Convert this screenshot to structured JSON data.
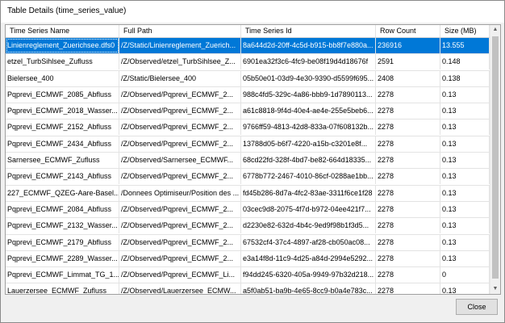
{
  "window": {
    "title": "Table Details (time_series_value)"
  },
  "table": {
    "columns": [
      "Time Series Name",
      "Full Path",
      "Time Series Id",
      "Row Count",
      "Size (MB)"
    ],
    "rows": [
      [
        "Linienreglement_Zuerichsee.dfs0",
        "/Z/Static/Linienreglement_Zuerich...",
        "8a644d2d-20ff-4c5d-b915-bb8f7e880a...",
        "236916",
        "13.555"
      ],
      [
        "etzel_TurbSihlsee_Zufluss",
        "/Z/Observed/etzel_TurbSihlsee_Z...",
        "6901ea32f3c6-4fc9-be08f19d4d18676f",
        "2591",
        "0.148"
      ],
      [
        "Bielersee_400",
        "/Z/Static/Bielersee_400",
        "05b50e01-03d9-4e30-9390-d5599f695...",
        "2408",
        "0.138"
      ],
      [
        "Pqprevi_ECMWF_2085_Abfluss",
        "/Z/Observed/Pqprevi_ECMWF_2...",
        "988c4fd5-329c-4a86-bbb9-1d7890113...",
        "2278",
        "0.13"
      ],
      [
        "Pqprevi_ECMWF_2018_Wasser...",
        "/Z/Observed/Pqprevi_ECMWF_2...",
        "a61c8818-9f4d-40e4-ae4e-255e5beb6...",
        "2278",
        "0.13"
      ],
      [
        "Pqprevi_ECMWF_2152_Abfluss",
        "/Z/Observed/Pqprevi_ECMWF_2...",
        "9766ff59-4813-42d8-833a-07f608132b...",
        "2278",
        "0.13"
      ],
      [
        "Pqprevi_ECMWF_2434_Abfluss",
        "/Z/Observed/Pqprevi_ECMWF_2...",
        "13788d05-b6f7-4220-a15b-c3201e8f...",
        "2278",
        "0.13"
      ],
      [
        "Sarnersee_ECMWF_Zufluss",
        "/Z/Observed/Sarnersee_ECMWF...",
        "68cd22fd-328f-4bd7-be82-664d18335...",
        "2278",
        "0.13"
      ],
      [
        "Pqprevi_ECMWF_2143_Abfluss",
        "/Z/Observed/Pqprevi_ECMWF_2...",
        "6778b772-2467-4010-86cf-0288ae1bb...",
        "2278",
        "0.13"
      ],
      [
        "227_ECMWF_QZEG-Aare-Basel...",
        "/Donnees Optimiseur/Position des ...",
        "fd45b286-8d7a-4fc2-83ae-3311f6ce1f28",
        "2278",
        "0.13"
      ],
      [
        "Pqprevi_ECMWF_2084_Abfluss",
        "/Z/Observed/Pqprevi_ECMWF_2...",
        "03cec9d8-2075-4f7d-b972-04ee421f7...",
        "2278",
        "0.13"
      ],
      [
        "Pqprevi_ECMWF_2132_Wasser...",
        "/Z/Observed/Pqprevi_ECMWF_2...",
        "d2230e82-632d-4b4c-9ed9f98b1f3d5...",
        "2278",
        "0.13"
      ],
      [
        "Pqprevi_ECMWF_2179_Abfluss",
        "/Z/Observed/Pqprevi_ECMWF_2...",
        "67532cf4-37c4-4897-af28-cb050ac08...",
        "2278",
        "0.13"
      ],
      [
        "Pqprevi_ECMWF_2289_Wasser...",
        "/Z/Observed/Pqprevi_ECMWF_2...",
        "e3a14f8d-11c9-4d25-a84d-2994e5292...",
        "2278",
        "0.13"
      ],
      [
        "Pqprevi_ECMWF_Limmat_TG_1...",
        "/Z/Observed/Pqprevi_ECMWF_Li...",
        "f94dd245-6320-405a-9949-97b32d218...",
        "2278",
        "0"
      ],
      [
        "Lauerzersee_ECMWF_Zufluss",
        "/Z/Observed/Lauerzersee_ECMW...",
        "a5f0ab51-ba9b-4e65-8cc9-b0a4e783c...",
        "2278",
        "0.13"
      ]
    ]
  },
  "buttons": {
    "close": "Close"
  },
  "icons": {
    "scroll_up": "chevron-up-icon",
    "scroll_down": "chevron-down-icon"
  },
  "colors": {
    "selection": "#0078d7"
  }
}
